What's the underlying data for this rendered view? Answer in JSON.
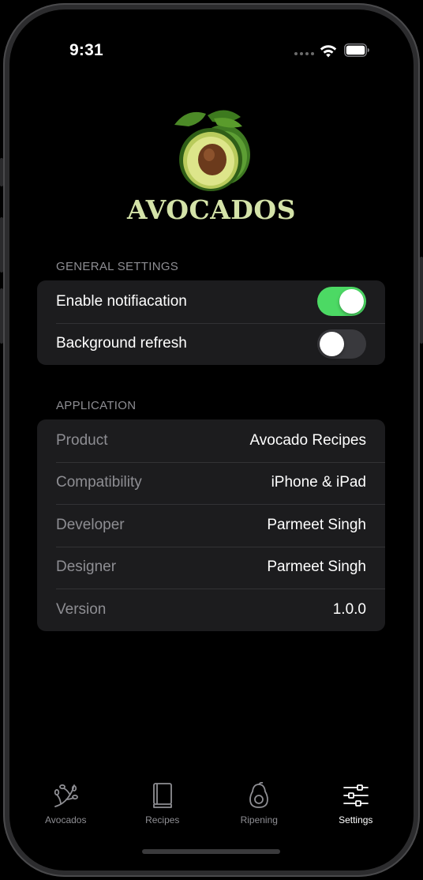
{
  "status_bar": {
    "time": "9:31"
  },
  "header": {
    "brand": "AVOCADOS",
    "logo_icon": "avocado-icon"
  },
  "general_settings": {
    "title": "GENERAL SETTINGS",
    "rows": [
      {
        "label": "Enable notifiacation",
        "toggle": true
      },
      {
        "label": "Background refresh",
        "toggle": false
      }
    ]
  },
  "application": {
    "title": "APPLICATION",
    "rows": [
      {
        "label": "Product",
        "value": "Avocado Recipes"
      },
      {
        "label": "Compatibility",
        "value": "iPhone & iPad"
      },
      {
        "label": "Developer",
        "value": "Parmeet Singh"
      },
      {
        "label": "Designer",
        "value": "Parmeet Singh"
      },
      {
        "label": "Version",
        "value": "1.0.0"
      }
    ]
  },
  "tabbar": {
    "tabs": [
      {
        "label": "Avocados",
        "icon": "branch-icon",
        "active": false
      },
      {
        "label": "Recipes",
        "icon": "book-icon",
        "active": false
      },
      {
        "label": "Ripening",
        "icon": "avocado-outline-icon",
        "active": false
      },
      {
        "label": "Settings",
        "icon": "sliders-icon",
        "active": true
      }
    ]
  },
  "colors": {
    "accent_toggle": "#4cd964",
    "brand_text": "#d4e3a8",
    "group_background": "#1c1c1e"
  }
}
